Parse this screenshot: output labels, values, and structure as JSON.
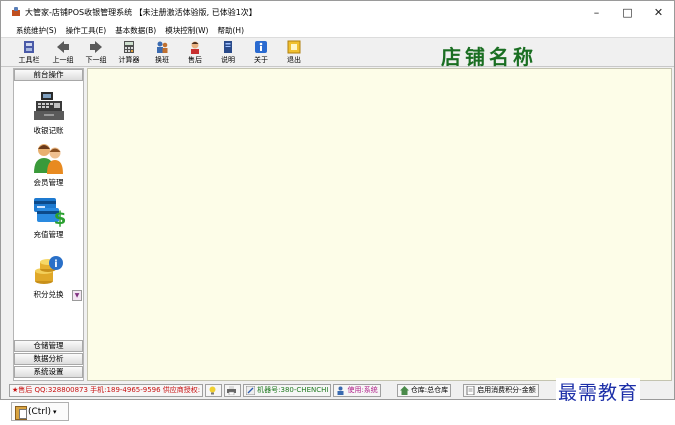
{
  "window": {
    "title": "大管家-店铺POS收银管理系统 【未注册激活体验版, 已体验1次】",
    "controls": {
      "minimize": "–",
      "maximize": "□",
      "close": "✕"
    }
  },
  "menu": [
    "系统维护(S)",
    "操作工具(E)",
    "基本数据(B)",
    "模块控制(W)",
    "帮助(H)"
  ],
  "toolbar": {
    "buttons": [
      {
        "label": "工具栏",
        "icon": "toolbar-icon"
      },
      {
        "label": "上一组",
        "icon": "arrow-left-icon"
      },
      {
        "label": "下一组",
        "icon": "arrow-right-icon"
      },
      {
        "label": "计算器",
        "icon": "calculator-icon"
      },
      {
        "label": "换班",
        "icon": "shift-change-icon"
      },
      {
        "label": "售后",
        "icon": "after-sales-icon"
      },
      {
        "label": "说明",
        "icon": "manual-icon"
      },
      {
        "label": "关于",
        "icon": "about-icon"
      },
      {
        "label": "退出",
        "icon": "exit-icon"
      }
    ],
    "store_name": "店铺名称"
  },
  "left_panel": {
    "header": "前台操作",
    "items": [
      {
        "label": "收银记账",
        "icon": "cash-register-icon"
      },
      {
        "label": "会员管理",
        "icon": "members-icon"
      },
      {
        "label": "充值管理",
        "icon": "recharge-card-icon"
      },
      {
        "label": "积分兑换",
        "icon": "points-coins-icon"
      }
    ],
    "scroll_down": "▼",
    "footer_groups": [
      "仓储管理",
      "数据分析",
      "系统设置"
    ]
  },
  "statusbar": {
    "contact": "★售后 QQ:328800873 手机:189-4965-9596 供应商授权:",
    "machine": "机器号:380-CHENCHI",
    "user": "使用:系统",
    "warehouse": "仓库:总仓库",
    "points": "启用消费积分-金额"
  },
  "watermark": "最需教育",
  "paste_options": {
    "label": "(Ctrl)",
    "arrow": "▾"
  },
  "colors": {
    "store_name": "#1a6e22",
    "main_background": "#fdfde8",
    "watermark": "#1c2fa8",
    "status_red": "#c81010"
  }
}
